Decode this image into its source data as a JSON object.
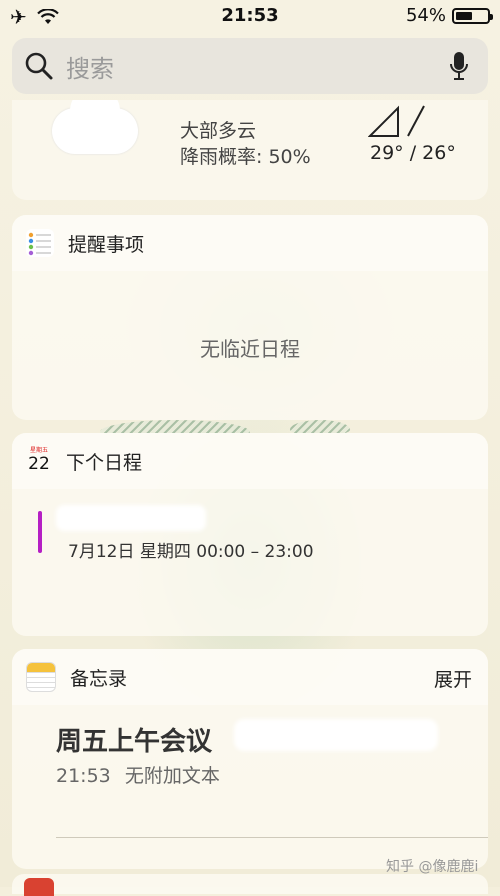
{
  "status_bar": {
    "time": "21:53",
    "battery": "54%",
    "battery_level": 0.54
  },
  "search": {
    "placeholder": "搜索"
  },
  "weather": {
    "condition": "大部多云",
    "precipitation": "降雨概率: 50%",
    "temperature": "29° / 26°"
  },
  "reminders": {
    "title": "提醒事项",
    "empty_text": "无临近日程"
  },
  "calendar": {
    "title": "下个日程",
    "icon_day": "22",
    "icon_weekday": "星期五",
    "event_time": "7月12日 星期四 00:00 – 23:00",
    "event_color": "#b51fc4"
  },
  "notes": {
    "title": "备忘录",
    "action": "展开",
    "note_title": "周五上午会议",
    "note_time": "21:53",
    "note_subtitle": "无附加文本"
  },
  "watermark": "知乎 @像鹿鹿i"
}
